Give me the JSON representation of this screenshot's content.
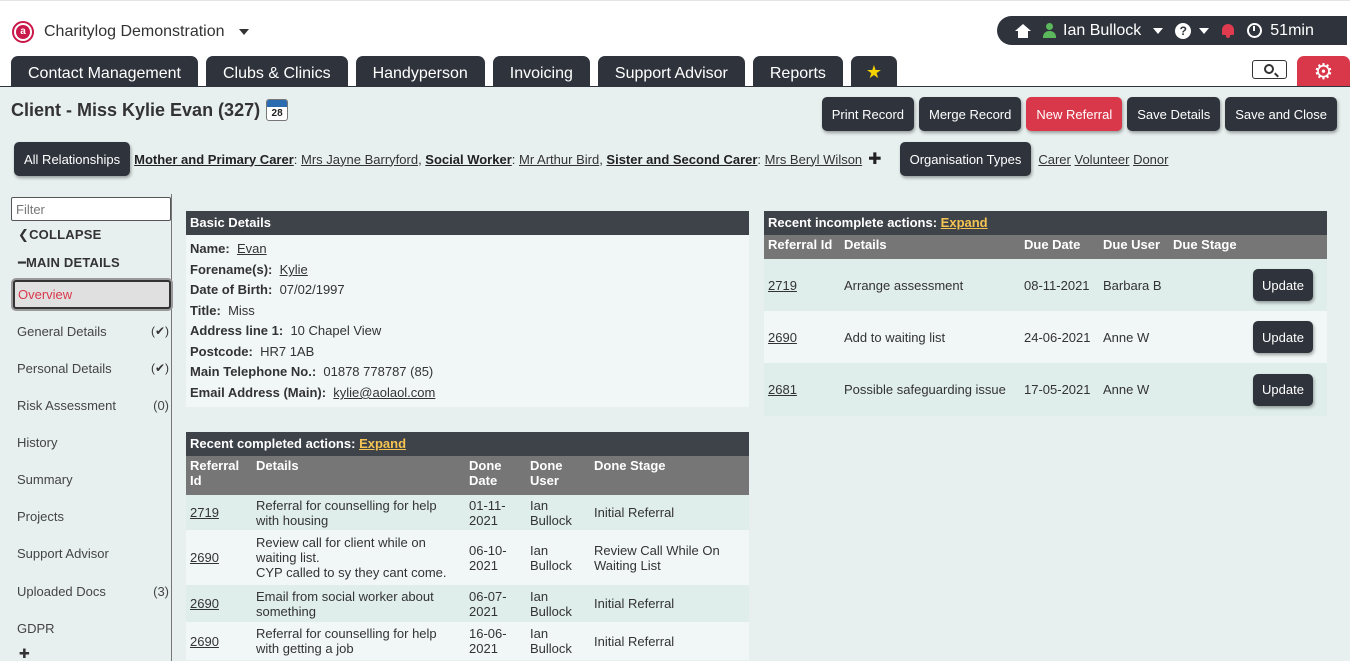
{
  "app": {
    "name": "Charitylog Demonstration"
  },
  "user": {
    "name": "Ian Bullock",
    "timer": "51min"
  },
  "tabs": [
    {
      "label": "Contact Management"
    },
    {
      "label": "Clubs & Clinics"
    },
    {
      "label": "Handyperson"
    },
    {
      "label": "Invoicing"
    },
    {
      "label": "Support Advisor"
    },
    {
      "label": "Reports"
    }
  ],
  "client": {
    "title": "Client - Miss Kylie Evan (327)",
    "calendar_day": "28"
  },
  "actions": {
    "print": "Print Record",
    "merge": "Merge Record",
    "new_referral": "New Referral",
    "save": "Save Details",
    "save_close": "Save and Close"
  },
  "relationships": {
    "button": "All Relationships",
    "items": [
      {
        "label": "Mother and Primary Carer",
        "name": "Mrs Jayne Barryford"
      },
      {
        "label": "Social Worker",
        "name": "Mr Arthur Bird"
      },
      {
        "label": "Sister and Second Carer",
        "name": "Mrs Beryl Wilson"
      }
    ],
    "org_button": "Organisation Types",
    "org_types": [
      "Carer",
      "Volunteer",
      "Donor"
    ]
  },
  "sidebar": {
    "filter_placeholder": "Filter",
    "collapse": "COLLAPSE",
    "section": "MAIN DETAILS",
    "items": [
      {
        "label": "Overview",
        "badge": ""
      },
      {
        "label": "General Details",
        "badge": "(✔)"
      },
      {
        "label": "Personal Details",
        "badge": "(✔)"
      },
      {
        "label": "Risk Assessment",
        "badge": "(0)"
      },
      {
        "label": "History",
        "badge": ""
      },
      {
        "label": "Summary",
        "badge": ""
      },
      {
        "label": "Projects",
        "badge": ""
      },
      {
        "label": "Support Advisor",
        "badge": ""
      },
      {
        "label": "Uploaded Docs",
        "badge": "(3)"
      },
      {
        "label": "GDPR",
        "badge": ""
      }
    ]
  },
  "basic_details": {
    "title": "Basic Details",
    "rows": [
      {
        "label": "Name:",
        "value": "Evan"
      },
      {
        "label": "Forename(s):",
        "value": "Kylie"
      },
      {
        "label": "Date of Birth:",
        "value": "07/02/1997"
      },
      {
        "label": "Title:",
        "value": "Miss"
      },
      {
        "label": "Address line 1:",
        "value": "10 Chapel View"
      },
      {
        "label": "Postcode:",
        "value": "HR7 1AB"
      },
      {
        "label": "Main Telephone No.:",
        "value": "01878 778787 (85)"
      },
      {
        "label": "Email Address (Main):",
        "value": "kylie@aolaol.com"
      }
    ]
  },
  "completed": {
    "title": "Recent completed actions:",
    "expand": "Expand",
    "headers": [
      "Referral Id",
      "Details",
      "Done Date",
      "Done User",
      "Done Stage"
    ],
    "rows": [
      {
        "id": "2719",
        "details": "Referral for counselling for help with housing",
        "date": "01-11-2021",
        "user": "Ian Bullock",
        "stage": "Initial Referral"
      },
      {
        "id": "2690",
        "details": "Review call for client while on waiting list.",
        "details2": "CYP called to sy they cant come.",
        "date": "06-10-2021",
        "user": "Ian Bullock",
        "stage": "Review Call While On Waiting List"
      },
      {
        "id": "2690",
        "details": "Email from social worker about something",
        "date": "06-07-2021",
        "user": "Ian Bullock",
        "stage": "Initial Referral"
      },
      {
        "id": "2690",
        "details": "Referral for counselling for help with getting a job",
        "date": "16-06-2021",
        "user": "Ian Bullock",
        "stage": "Initial Referral"
      }
    ]
  },
  "incomplete": {
    "title": "Recent incomplete actions:",
    "expand": "Expand",
    "headers": [
      "Referral Id",
      "Details",
      "Due Date",
      "Due User",
      "Due Stage",
      ""
    ],
    "update_label": "Update",
    "rows": [
      {
        "id": "2719",
        "details": "Arrange assessment",
        "date": "08-11-2021",
        "user": "Barbara B",
        "stage": ""
      },
      {
        "id": "2690",
        "details": "Add to waiting list",
        "date": "24-06-2021",
        "user": "Anne W",
        "stage": ""
      },
      {
        "id": "2681",
        "details": "Possible safeguarding issue",
        "date": "17-05-2021",
        "user": "Anne W",
        "stage": ""
      }
    ]
  }
}
